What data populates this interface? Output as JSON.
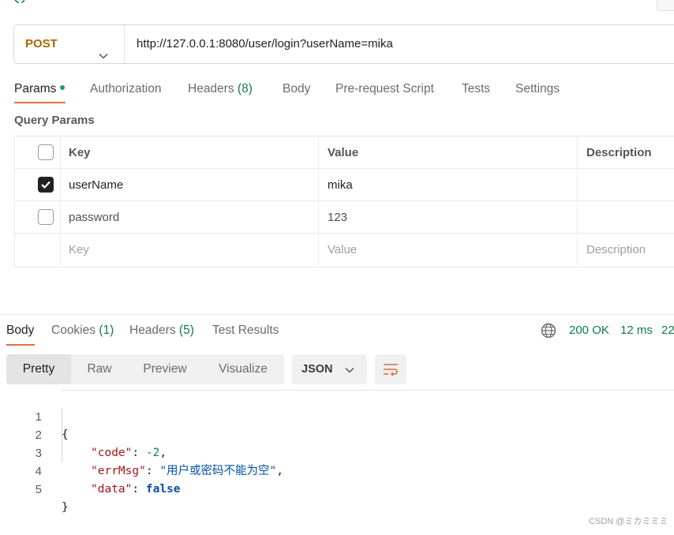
{
  "request": {
    "method": "POST",
    "url": "http://127.0.0.1:8080/user/login?userName=mika"
  },
  "request_tabs": {
    "params": "Params",
    "authorization": "Authorization",
    "headers": "Headers",
    "headers_count": "(8)",
    "body": "Body",
    "prerequest": "Pre-request Script",
    "tests": "Tests",
    "settings": "Settings"
  },
  "query_params": {
    "title": "Query Params",
    "headers": {
      "key": "Key",
      "value": "Value",
      "description": "Description"
    },
    "rows": [
      {
        "checked": true,
        "key": "userName",
        "value": "mika"
      },
      {
        "checked": false,
        "key": "password",
        "value": "123"
      }
    ],
    "new_row": {
      "key": "Key",
      "value": "Value",
      "description": "Description"
    }
  },
  "response_tabs": {
    "body": "Body",
    "cookies": "Cookies",
    "cookies_count": "(1)",
    "headers": "Headers",
    "headers_count": "(5)",
    "test_results": "Test Results"
  },
  "response_status": {
    "status": "200 OK",
    "time": "12 ms",
    "size": "22"
  },
  "view": {
    "modes": [
      "Pretty",
      "Raw",
      "Preview",
      "Visualize"
    ],
    "active_mode": "Pretty",
    "format": "JSON"
  },
  "code": {
    "line_numbers": [
      "1",
      "2",
      "3",
      "4",
      "5"
    ],
    "open_brace": "{",
    "close_brace": "}",
    "code_key": "\"code\"",
    "code_value": "-2",
    "errmsg_key": "\"errMsg\"",
    "errmsg_value": "\"用户或密码不能为空\"",
    "data_key": "\"data\"",
    "data_value": "false"
  },
  "watermark": "CSDN @ミカミミミ",
  "colors": {
    "accent": "#e46f3b",
    "method": "#a16b00",
    "success": "#0f7a4f"
  }
}
